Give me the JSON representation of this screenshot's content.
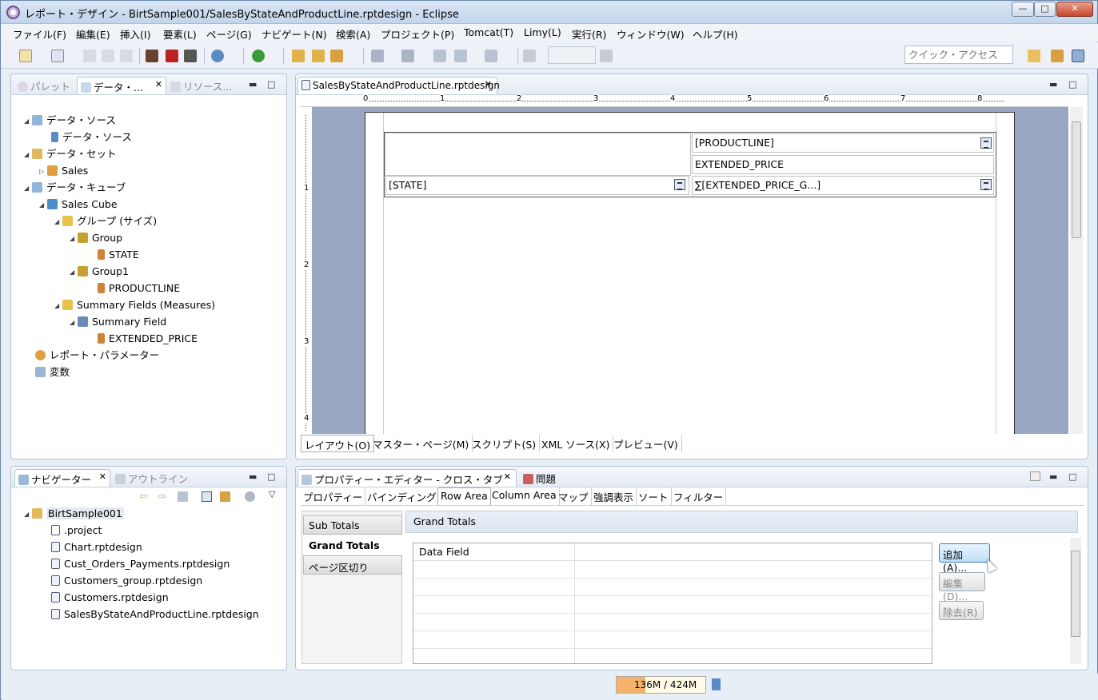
{
  "window": {
    "title": "レポート・デザイン - BirtSample001/SalesByStateAndProductLine.rptdesign - Eclipse",
    "min": "—",
    "max": "□",
    "close": "✕"
  },
  "menu": [
    "ファイル(F)",
    "編集(E)",
    "挿入(I)",
    "要素(L)",
    "ページ(G)",
    "ナビゲート(N)",
    "検索(A)",
    "プロジェクト(P)",
    "Tomcat(T)",
    "Limy(L)",
    "実行(R)",
    "ウィンドウ(W)",
    "ヘルプ(H)"
  ],
  "toolbar": {
    "quick_access_placeholder": "クイック・アクセス"
  },
  "left_top": {
    "tabs": [
      "パレット",
      "データ・...",
      "リソース..."
    ],
    "tree": [
      "データ・ソース",
      "データ・ソース",
      "データ・セット",
      "Sales",
      "データ・キューブ",
      "Sales Cube",
      "グループ (サイズ)",
      "Group",
      "STATE",
      "Group1",
      "PRODUCTLINE",
      "Summary Fields (Measures)",
      "Summary Field",
      "EXTENDED_PRICE",
      "レポート・パラメーター",
      "変数"
    ]
  },
  "left_bottom": {
    "tabs": [
      "ナビゲーター",
      "アウトライン"
    ],
    "tree": [
      "BirtSample001",
      ".project",
      "Chart.rptdesign",
      "Cust_Orders_Payments.rptdesign",
      "Customers_group.rptdesign",
      "Customers.rptdesign",
      "SalesByStateAndProductLine.rptdesign"
    ]
  },
  "editor": {
    "tab": "SalesByStateAndProductLine.rptdesign",
    "ruler": [
      "0",
      "1",
      "2",
      "3",
      "4",
      "5",
      "6",
      "7",
      "8"
    ],
    "vruler": [
      "1",
      "2",
      "3",
      "4"
    ],
    "crosstab": {
      "productline": "[PRODUCTLINE]",
      "measure": "EXTENDED_PRICE",
      "state": "[STATE]",
      "sum": "∑[EXTENDED_PRICE_G...]"
    },
    "bottom_tabs": [
      "レイアウト(O)",
      "マスター・ページ(M)",
      "スクリプト(S)",
      "XML ソース(X)",
      "プレビュー(V)"
    ]
  },
  "properties": {
    "tabs": [
      "プロパティー・エディター - クロス・タブ",
      "問題"
    ],
    "subtabs": [
      "プロパティー",
      "バインディング",
      "Row Area",
      "Column Area",
      "マップ",
      "強調表示",
      "ソート",
      "フィルター"
    ],
    "side": [
      "Sub Totals",
      "Grand Totals",
      "ページ区切り"
    ],
    "section_title": "Grand Totals",
    "table_header": "Data Field",
    "buttons": {
      "add": "追加(A)...",
      "edit": "編集(D)...",
      "remove": "除去(R)"
    }
  },
  "status": {
    "memory": "136M / 424M",
    "memory_used_fraction": 0.32
  }
}
